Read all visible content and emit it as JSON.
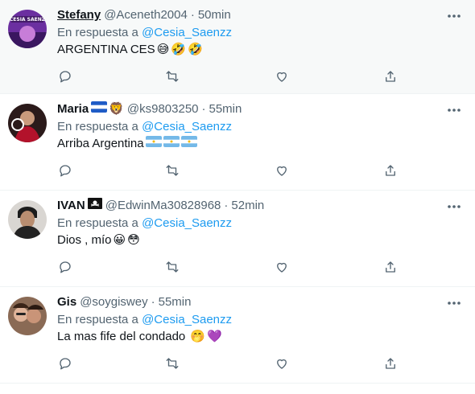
{
  "tweets": [
    {
      "name": "Stefany",
      "handle": "@Aceneth2004",
      "sep": "·",
      "time": "50min",
      "reply_prefix": "En respuesta a",
      "reply_to": "@Cesia_Saenzz",
      "text": "ARGENTINA CES",
      "emojis": [
        "😅",
        "🤣",
        "🤣"
      ],
      "avatar_text": "CESIA SAENZ"
    },
    {
      "name": "Maria",
      "name_emojis": [
        "flag-honduras",
        "🦁"
      ],
      "handle": "@ks9803250",
      "sep": "·",
      "time": "55min",
      "reply_prefix": "En respuesta a",
      "reply_to": "@Cesia_Saenzz",
      "text": "Arriba Argentina",
      "emojis": [
        "flag-argentina",
        "flag-argentina",
        "flag-argentina"
      ]
    },
    {
      "name": "IVAN",
      "name_emojis": [
        "🏴‍☠️"
      ],
      "handle": "@EdwinMa30828968",
      "sep": "·",
      "time": "52min",
      "reply_prefix": "En respuesta a",
      "reply_to": "@Cesia_Saenzz",
      "text": "Dios , mío",
      "emojis": [
        "😀",
        "😳"
      ]
    },
    {
      "name": "Gis",
      "handle": "@soygiswey",
      "sep": "·",
      "time": "55min",
      "reply_prefix": "En respuesta a",
      "reply_to": "@Cesia_Saenzz",
      "text": "La mas fife del condado",
      "emojis": [
        "🤭",
        "💜"
      ]
    }
  ],
  "icons": {
    "more": "more-horizontal-icon",
    "reply": "reply-bubble-icon",
    "retweet": "retweet-icon",
    "like": "heart-icon",
    "share": "share-upload-icon"
  },
  "colors": {
    "link": "#1d9bf0",
    "secondary": "#536471",
    "text": "#0f1419",
    "divider": "#eff3f4",
    "highlight_bg": "#f7f9f9"
  }
}
